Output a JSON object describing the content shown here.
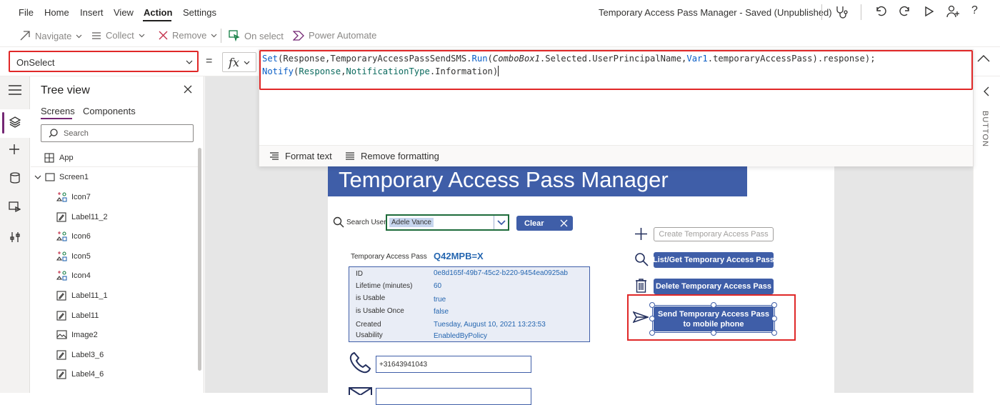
{
  "menu": {
    "items": [
      "File",
      "Home",
      "Insert",
      "View",
      "Action",
      "Settings"
    ],
    "active": "Action",
    "app_title": "Temporary Access Pass Manager - Saved (Unpublished)"
  },
  "toolbar": {
    "navigate": "Navigate",
    "collect": "Collect",
    "remove": "Remove",
    "on_select": "On select",
    "power_automate": "Power Automate"
  },
  "formula": {
    "property": "OnSelect",
    "equals": "=",
    "fx": "fx",
    "line1": {
      "set": "Set",
      "p1": "(Response,TemporaryAccessPassSendSMS.",
      "run": "Run",
      "p2": "(",
      "combo": "ComboBox1",
      "p3": ".Selected.UserPrincipalName,",
      "var": "Var1",
      "p4": ".temporaryAccessPass).response);"
    },
    "line2": {
      "notify": "Notify",
      "p1": "(",
      "response": "Response",
      "p2": ",",
      "nt": "NotificationType",
      "p3": ".Information)"
    },
    "format_text": "Format text",
    "remove_formatting": "Remove formatting"
  },
  "right_panel": {
    "label": "BUTTON"
  },
  "tree": {
    "title": "Tree view",
    "tabs": [
      "Screens",
      "Components"
    ],
    "search_placeholder": "Search",
    "app": "App",
    "screen": "Screen1",
    "items": [
      {
        "label": "Icon7",
        "icon": "icon-control-icon"
      },
      {
        "label": "Label11_2",
        "icon": "label-control-icon"
      },
      {
        "label": "Icon6",
        "icon": "icon-control-icon"
      },
      {
        "label": "Icon5",
        "icon": "icon-control-icon"
      },
      {
        "label": "Icon4",
        "icon": "icon-control-icon"
      },
      {
        "label": "Label11_1",
        "icon": "label-control-icon"
      },
      {
        "label": "Label11",
        "icon": "label-control-icon"
      },
      {
        "label": "Image2",
        "icon": "image-control-icon"
      },
      {
        "label": "Label3_6",
        "icon": "label-control-icon"
      },
      {
        "label": "Label4_6",
        "icon": "label-control-icon"
      }
    ]
  },
  "app": {
    "title": "Temporary Access Pass Manager",
    "search_label": "Search User",
    "search_value": "Adele Vance",
    "clear": "Clear",
    "tap_label": "Temporary Access Pass",
    "tap_value": "Q42MPB=X",
    "details": [
      {
        "label": "ID",
        "value": "0e8d165f-49b7-45c2-b220-9454ea0925ab"
      },
      {
        "label": "Lifetime (minutes)",
        "value": "60"
      },
      {
        "label": "is Usable",
        "value": "true"
      },
      {
        "label": "is Usable Once",
        "value": "false"
      },
      {
        "label": "Created",
        "value": "Tuesday, August 10, 2021 13:23:53"
      },
      {
        "label": "Usability",
        "value": "EnabledByPolicy"
      }
    ],
    "phone": "+31643941043",
    "buttons": {
      "create": "Create Temporary Access Pass",
      "list": "List/Get Temporary Access Pass",
      "delete": "Delete Temporary Access Pass",
      "send": "Send Temporary Access Pass to mobile phone"
    }
  }
}
